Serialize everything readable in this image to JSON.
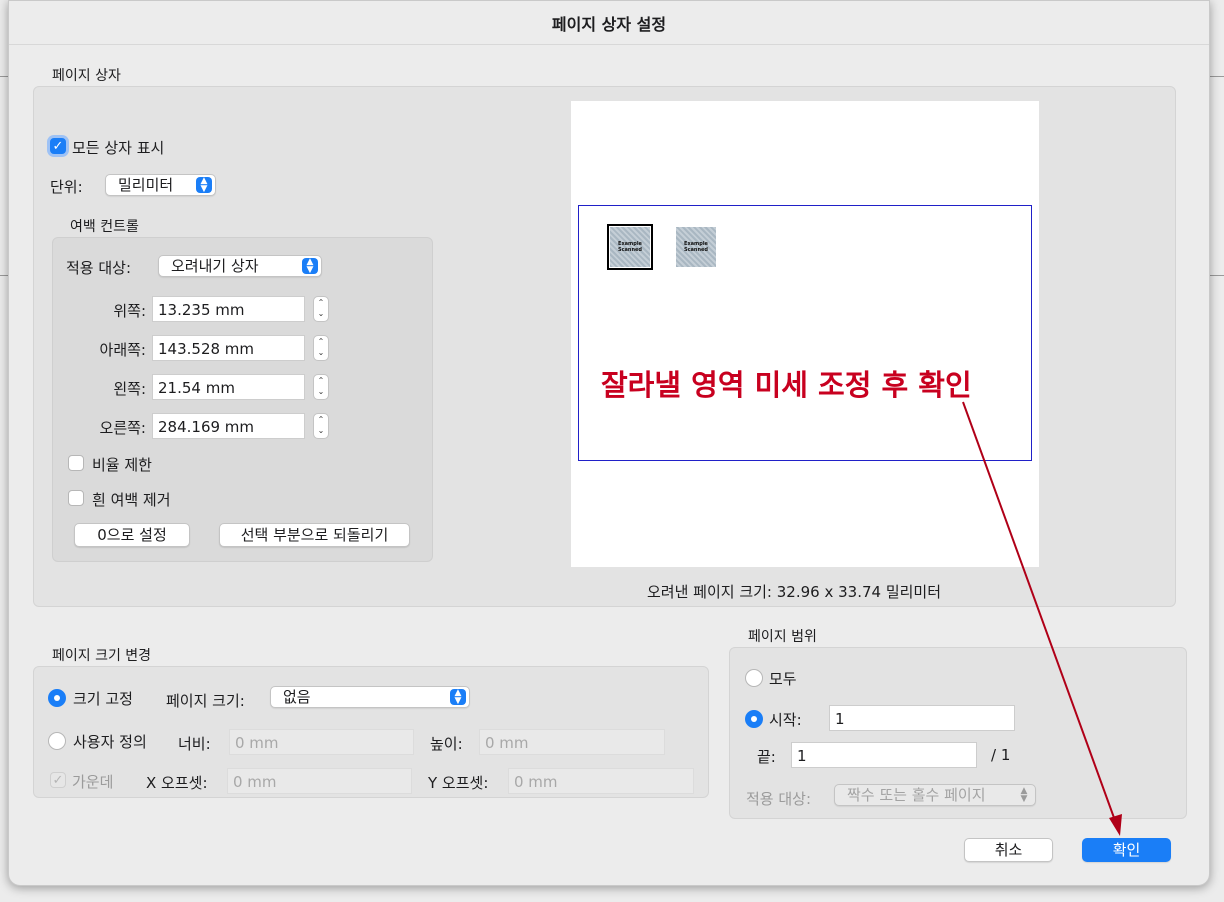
{
  "dialog": {
    "title": "페이지 상자 설정"
  },
  "page_box": {
    "section_label": "페이지 상자",
    "show_all_boxes": {
      "label": "모든 상자 표시",
      "checked": true
    },
    "unit": {
      "label": "단위:",
      "value": "밀리미터"
    },
    "margin_controls": {
      "section_label": "여백 컨트롤",
      "apply_to": {
        "label": "적용 대상:",
        "value": "오려내기 상자"
      },
      "top": {
        "label": "위쪽:",
        "value": "13.235 mm"
      },
      "bottom": {
        "label": "아래쪽:",
        "value": "143.528 mm"
      },
      "left": {
        "label": "왼쪽:",
        "value": "21.54 mm"
      },
      "right": {
        "label": "오른쪽:",
        "value": "284.169 mm"
      },
      "constrain_proportions": {
        "label": "비율 제한",
        "checked": false
      },
      "remove_white_margins": {
        "label": "흰 여백 제거",
        "checked": false
      },
      "set_to_zero_label": "0으로 설정",
      "revert_label": "선택 부분으로 되돌리기"
    },
    "preview": {
      "thumb_text": "Example Scanned",
      "crop_size_text": "오려낸 페이지 크기: 32.96 x 33.74 밀리미터"
    }
  },
  "annotation": {
    "text": "잘라낼 영역 미세 조정 후 확인",
    "color": "#c8001f"
  },
  "page_size": {
    "section_label": "페이지 크기 변경",
    "fixed": {
      "label": "크기 고정",
      "selected": true
    },
    "page_size": {
      "label": "페이지 크기:",
      "value": "없음"
    },
    "custom": {
      "label": "사용자 정의",
      "selected": false
    },
    "width": {
      "label": "너비:",
      "placeholder": "0 mm"
    },
    "height": {
      "label": "높이:",
      "placeholder": "0 mm"
    },
    "center": {
      "label": "가운데",
      "checked": true,
      "disabled": true
    },
    "x_offset": {
      "label": "X 오프셋:",
      "placeholder": "0 mm"
    },
    "y_offset": {
      "label": "Y 오프셋:",
      "placeholder": "0 mm"
    }
  },
  "page_range": {
    "section_label": "페이지 범위",
    "all": {
      "label": "모두",
      "selected": false
    },
    "from": {
      "label": "시작:",
      "value": "1",
      "selected": true
    },
    "to": {
      "label": "끝:",
      "value": "1",
      "total": "/ 1"
    },
    "apply_to": {
      "label": "적용 대상:",
      "value": "짝수 또는 홀수 페이지"
    }
  },
  "buttons": {
    "cancel": "취소",
    "ok": "확인"
  },
  "colors": {
    "accent": "#1a7ef7",
    "crop_box": "#2020c8",
    "arrow": "#b00018"
  }
}
